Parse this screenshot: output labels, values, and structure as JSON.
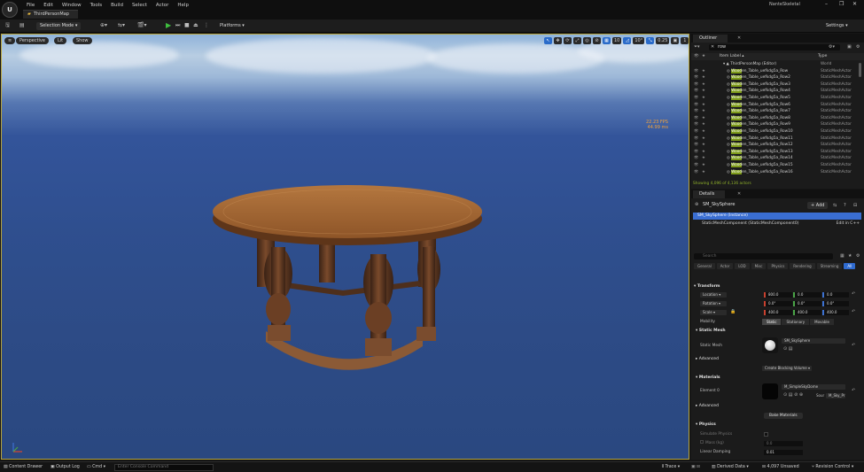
{
  "app": {
    "logo_text": "U",
    "project_name": "NanteSkeletal",
    "map_tab": "ThirdPersonMap"
  },
  "menu": [
    "File",
    "Edit",
    "Window",
    "Tools",
    "Build",
    "Select",
    "Actor",
    "Help"
  ],
  "window_controls": {
    "minimize": "–",
    "maximize": "❐",
    "close": "✕"
  },
  "toolbar": {
    "selection_mode": "Selection Mode ▾",
    "platforms": "Platforms ▾",
    "settings": "Settings ▾"
  },
  "viewport": {
    "perspective": "Perspective",
    "lit": "Lit",
    "show": "Show",
    "right_tools": [
      "↖",
      "✥",
      "⟳",
      "⤢",
      "◎",
      "⊘",
      "▦",
      "10",
      "◿",
      "10°",
      "⤡",
      "0.25",
      "▣",
      "1",
      "▢"
    ],
    "fps": "22.23 FPS",
    "ms": "44.99 ms"
  },
  "outliner": {
    "tab": "Outliner",
    "search_value": "row",
    "col_label": "Item Label ▴",
    "col_type": "Type",
    "world": {
      "label": "ThirdPersonMap (Editor)",
      "type": "World"
    },
    "rows": [
      {
        "hl": "Wood",
        "rest": "en_Table_uefkdg5a_Row",
        "type": "StaticMeshActor"
      },
      {
        "hl": "Wood",
        "rest": "en_Table_uefkdg5a_Row2",
        "type": "StaticMeshActor"
      },
      {
        "hl": "Wood",
        "rest": "en_Table_uefkdg5a_Row3",
        "type": "StaticMeshActor"
      },
      {
        "hl": "Wood",
        "rest": "en_Table_uefkdg5a_Row4",
        "type": "StaticMeshActor"
      },
      {
        "hl": "Wood",
        "rest": "en_Table_uefkdg5a_Row5",
        "type": "StaticMeshActor"
      },
      {
        "hl": "Wood",
        "rest": "en_Table_uefkdg5a_Row6",
        "type": "StaticMeshActor"
      },
      {
        "hl": "Wood",
        "rest": "en_Table_uefkdg5a_Row7",
        "type": "StaticMeshActor"
      },
      {
        "hl": "Wood",
        "rest": "en_Table_uefkdg5a_Row8",
        "type": "StaticMeshActor"
      },
      {
        "hl": "Wood",
        "rest": "en_Table_uefkdg5a_Row9",
        "type": "StaticMeshActor"
      },
      {
        "hl": "Wood",
        "rest": "en_Table_uefkdg5a_Row10",
        "type": "StaticMeshActor"
      },
      {
        "hl": "Wood",
        "rest": "en_Table_uefkdg5a_Row11",
        "type": "StaticMeshActor"
      },
      {
        "hl": "Wood",
        "rest": "en_Table_uefkdg5a_Row12",
        "type": "StaticMeshActor"
      },
      {
        "hl": "Wood",
        "rest": "en_Table_uefkdg5a_Row13",
        "type": "StaticMeshActor"
      },
      {
        "hl": "Wood",
        "rest": "en_Table_uefkdg5a_Row14",
        "type": "StaticMeshActor"
      },
      {
        "hl": "Wood",
        "rest": "en_Table_uefkdg5a_Row15",
        "type": "StaticMeshActor"
      },
      {
        "hl": "Wood",
        "rest": "en_Table_uefkdg5a_Row16",
        "type": "StaticMeshActor"
      }
    ],
    "status": "Showing 4,096 of 4,136 actors"
  },
  "details": {
    "tab": "Details",
    "object_name": "SM_SkySphere",
    "add": "+ Add",
    "instance_row": "SM_SkySphere (Instance)",
    "component_row": "StaticMeshComponent (StaticMeshComponent0)",
    "edit_cpp": "Edit in C++",
    "search_placeholder": "Search",
    "categories": [
      "General",
      "Actor",
      "LOD",
      "Misc",
      "Physics",
      "Rendering",
      "Streaming",
      "All"
    ],
    "transform": {
      "section": "Transform",
      "location_label": "Location ▾",
      "rotation_label": "Rotation ▾",
      "scale_label": "Scale ▾",
      "location": [
        "800.0",
        "0.0",
        "0.0"
      ],
      "rotation": [
        "0.0°",
        "0.0°",
        "0.0°"
      ],
      "scale": [
        "400.0",
        "400.0",
        "400.0"
      ],
      "mobility_label": "Mobility",
      "mobility": [
        "Static",
        "Stationary",
        "Movable"
      ]
    },
    "static_mesh": {
      "section": "Static Mesh",
      "label": "Static Mesh",
      "value": "SM_SkySphere"
    },
    "advanced_1": "Advanced",
    "create_blocking": "Create Blocking Volume ▾",
    "materials": {
      "section": "Materials",
      "label": "Element 0",
      "value": "M_SimpleSkyDome",
      "source": "Sour",
      "source_value": "M_Sky_Pr"
    },
    "advanced_2": "Advanced",
    "bake_materials": "Bake Materials",
    "physics": {
      "section": "Physics",
      "simulate": "Simulate Physics",
      "mass": "Mass (kg)",
      "mass_value": "0.0",
      "linear_damping": "Linear Damping",
      "linear_damping_value": "0.01"
    }
  },
  "statusbar": {
    "content_drawer": "Content Drawer",
    "output_log": "Output Log",
    "cmd": "Cmd ▾",
    "console_placeholder": "Enter Console Command",
    "trace": "Trace ▾",
    "derived_data": "Derived Data ▾",
    "unsaved": "4,097 Unsaved",
    "revision_control": "Revision Control ▾"
  }
}
